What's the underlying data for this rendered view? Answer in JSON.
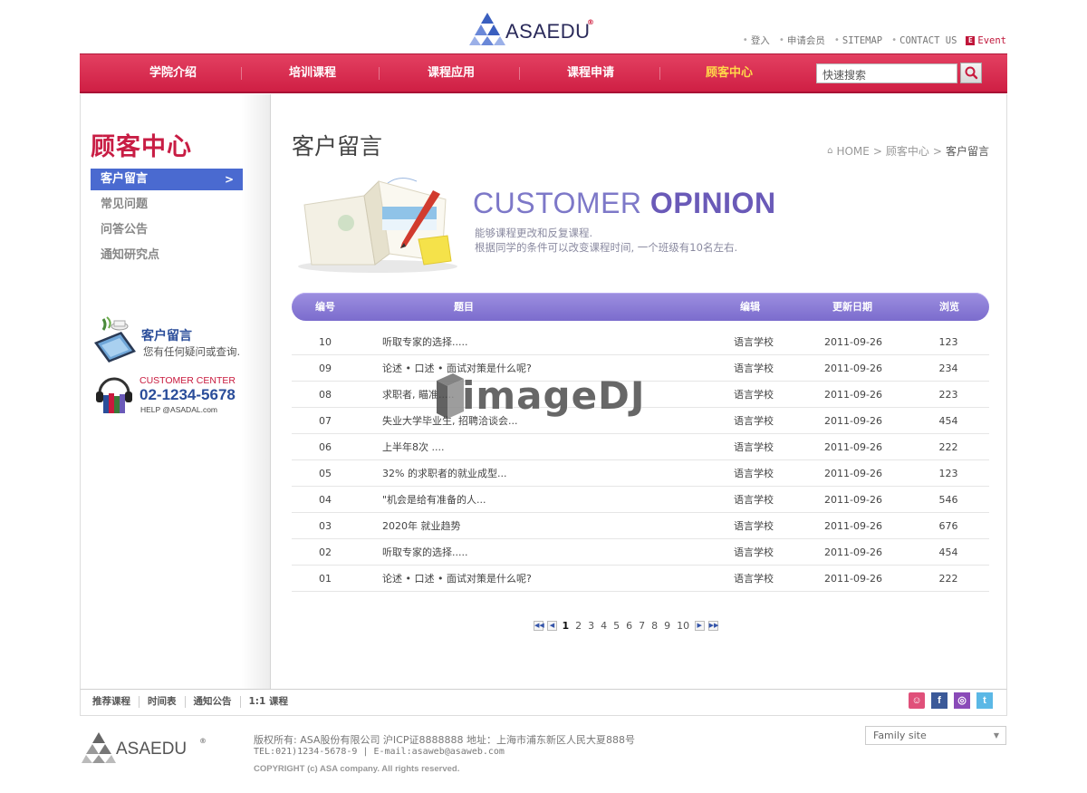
{
  "brand": {
    "name": "ASAEDU",
    "reg": "®"
  },
  "top_links": [
    {
      "label": "登入"
    },
    {
      "label": "申请会员"
    },
    {
      "label": "SITEMAP"
    },
    {
      "label": "CONTACT US"
    },
    {
      "label": "Event"
    }
  ],
  "nav": {
    "items": [
      {
        "label": "学院介绍"
      },
      {
        "label": "培训课程"
      },
      {
        "label": "课程应用"
      },
      {
        "label": "课程申请"
      },
      {
        "label": "顾客中心"
      }
    ],
    "search_placeholder": "快速搜索"
  },
  "sidebar": {
    "title": "顾客中心",
    "menu": [
      {
        "label": "客户留言"
      },
      {
        "label": "常见问题"
      },
      {
        "label": "问答公告"
      },
      {
        "label": "通知研究点"
      }
    ],
    "banner1": {
      "title": "客户留言",
      "subtitle": "您有任何疑问或查询."
    },
    "banner2": {
      "label": "CUSTOMER CENTER",
      "phone": "02-1234-5678",
      "help": "HELP @ASADAL.com"
    }
  },
  "main": {
    "title": "客户留言",
    "breadcrumb": [
      "HOME",
      "顾客中心",
      "客户留言"
    ],
    "hero": {
      "title_part1": "CUSTOMER ",
      "title_part2": "OPINION",
      "line1": "能够课程更改和反复课程.",
      "line2": "根据同学的条件可以改变课程时间, 一个班级有10名左右."
    },
    "table": {
      "headers": {
        "num": "编号",
        "title": "题目",
        "author": "编辑",
        "date": "更新日期",
        "views": "浏览"
      },
      "rows": [
        {
          "num": "10",
          "title": "听取专家的选择.....",
          "author": "语言学校",
          "date": "2011-09-26",
          "views": "123"
        },
        {
          "num": "09",
          "title": "论述 • 口述 • 面试对策是什么呢?",
          "author": "语言学校",
          "date": "2011-09-26",
          "views": "234"
        },
        {
          "num": "08",
          "title": "求职者, 瞄准.....",
          "author": "语言学校",
          "date": "2011-09-26",
          "views": "223"
        },
        {
          "num": "07",
          "title": "失业大学毕业生, 招聘洽谈会...",
          "author": "语言学校",
          "date": "2011-09-26",
          "views": "454"
        },
        {
          "num": "06",
          "title": "上半年8次 ....",
          "author": "语言学校",
          "date": "2011-09-26",
          "views": "222"
        },
        {
          "num": "05",
          "title": "32% 的求职者的就业成型...",
          "author": "语言学校",
          "date": "2011-09-26",
          "views": "123"
        },
        {
          "num": "04",
          "title": "\"机会是给有准备的人...",
          "author": "语言学校",
          "date": "2011-09-26",
          "views": "546"
        },
        {
          "num": "03",
          "title": "2020年 就业趋势",
          "author": "语言学校",
          "date": "2011-09-26",
          "views": "676"
        },
        {
          "num": "02",
          "title": "听取专家的选择.....",
          "author": "语言学校",
          "date": "2011-09-26",
          "views": "454"
        },
        {
          "num": "01",
          "title": "论述 • 口述 • 面试对策是什么呢?",
          "author": "语言学校",
          "date": "2011-09-26",
          "views": "222"
        }
      ]
    },
    "pagination": {
      "pages": [
        "1",
        "2",
        "3",
        "4",
        "5",
        "6",
        "7",
        "8",
        "9",
        "10"
      ],
      "current": "1"
    }
  },
  "footer": {
    "links": [
      "推荐课程",
      "时间表",
      "通知公告",
      "1:1 课程"
    ],
    "social": [
      "kakao-icon",
      "facebook-icon",
      "blog-icon",
      "twitter-icon"
    ],
    "info1": "版权所有: ASA股份有限公司 沪ICP证8888888 地址：上海市浦东新区人民大夏888号",
    "info2": "TEL:021)1234-5678-9 | E-mail:asaweb@asaweb.com",
    "copyright": "COPYRIGHT (c) ASA company. All rights reserved.",
    "family_site": "Family site"
  },
  "watermark": "imageDJ",
  "colors": {
    "nav_red": "#d42a4e",
    "accent_yellow": "#ffd84a",
    "purple": "#7b6ccd",
    "side_blue": "#4a6ad0"
  }
}
